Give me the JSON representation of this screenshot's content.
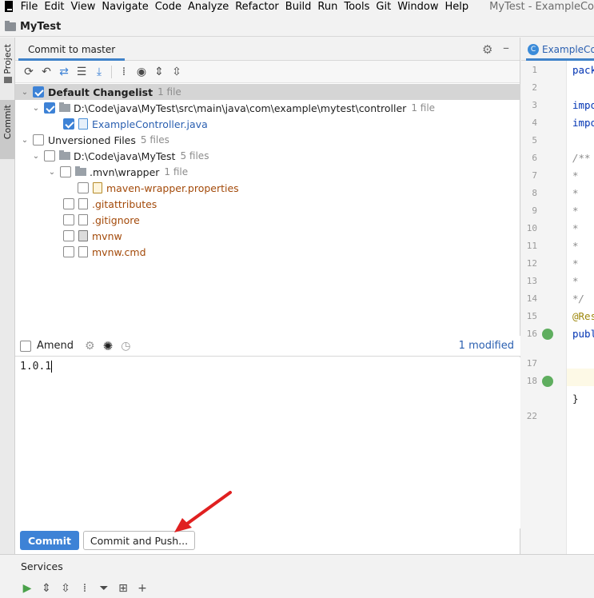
{
  "menubar": {
    "items": [
      "File",
      "Edit",
      "View",
      "Navigate",
      "Code",
      "Analyze",
      "Refactor",
      "Build",
      "Run",
      "Tools",
      "Git",
      "Window",
      "Help"
    ],
    "window_title": "MyTest - ExampleCo"
  },
  "project": {
    "name": "MyTest"
  },
  "left_stripe": {
    "project_label": "Project",
    "commit_label": "Commit"
  },
  "commit_panel": {
    "tab_label": "Commit to master",
    "tree": [
      {
        "label": "Default Changelist",
        "count": "1 file"
      },
      {
        "label": "D:\\Code\\java\\MyTest\\src\\main\\java\\com\\example\\mytest\\controller",
        "count": "1 file"
      },
      {
        "label": "ExampleController.java"
      },
      {
        "label": "Unversioned Files",
        "count": "5 files"
      },
      {
        "label": "D:\\Code\\java\\MyTest",
        "count": "5 files"
      },
      {
        "label": ".mvn\\wrapper",
        "count": "1 file"
      },
      {
        "label": "maven-wrapper.properties"
      },
      {
        "label": ".gitattributes"
      },
      {
        "label": ".gitignore"
      },
      {
        "label": "mvnw"
      },
      {
        "label": "mvnw.cmd"
      }
    ],
    "amend_label": "Amend",
    "modified_status": "1 modified",
    "commit_message": "1.0.1",
    "commit_button": "Commit",
    "commit_push_button": "Commit and Push..."
  },
  "editor": {
    "tab_label": "ExampleCo",
    "line_numbers": [
      "1",
      "2",
      "3",
      "4",
      "5",
      "6",
      "7",
      "8",
      "9",
      "10",
      "11",
      "12",
      "13",
      "14",
      "15",
      "16",
      "17",
      "18",
      "22"
    ],
    "code": {
      "l1": "pack",
      "l3": "impo",
      "l4": "impo",
      "l6": "/**",
      "l7": " * ",
      "l8": " * ",
      "l9": " * ",
      "l10": " * ",
      "l11": " * ",
      "l12": " * ",
      "l13": " * ",
      "l14": " */",
      "l15": "@Res",
      "l16": "publ",
      "l22": "}"
    }
  },
  "services": {
    "title": "Services"
  }
}
